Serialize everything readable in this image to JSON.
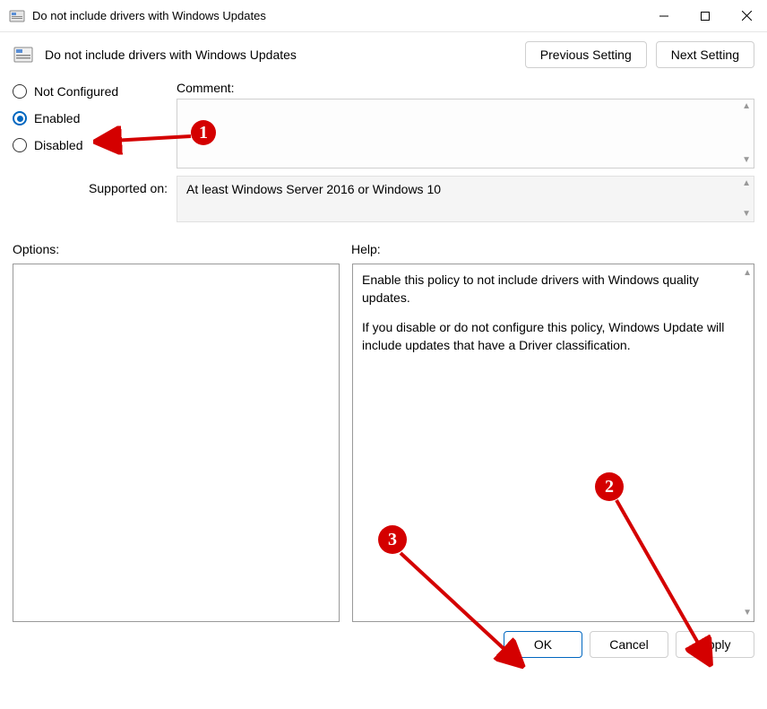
{
  "window": {
    "title": "Do not include drivers with Windows Updates"
  },
  "header": {
    "policy_title": "Do not include drivers with Windows Updates",
    "prev_btn": "Previous Setting",
    "next_btn": "Next Setting"
  },
  "state": {
    "not_configured": "Not Configured",
    "enabled": "Enabled",
    "disabled": "Disabled",
    "selected": "enabled"
  },
  "comment": {
    "label": "Comment:",
    "value": ""
  },
  "supported": {
    "label": "Supported on:",
    "value": "At least Windows Server 2016 or Windows 10"
  },
  "options": {
    "label": "Options:"
  },
  "help": {
    "label": "Help:",
    "p1": "Enable this policy to not include drivers with Windows quality updates.",
    "p2": "If you disable or do not configure this policy, Windows Update will include updates that have a Driver classification."
  },
  "buttons": {
    "ok": "OK",
    "cancel": "Cancel",
    "apply": "Apply"
  },
  "annotations": {
    "b1": "1",
    "b2": "2",
    "b3": "3"
  }
}
